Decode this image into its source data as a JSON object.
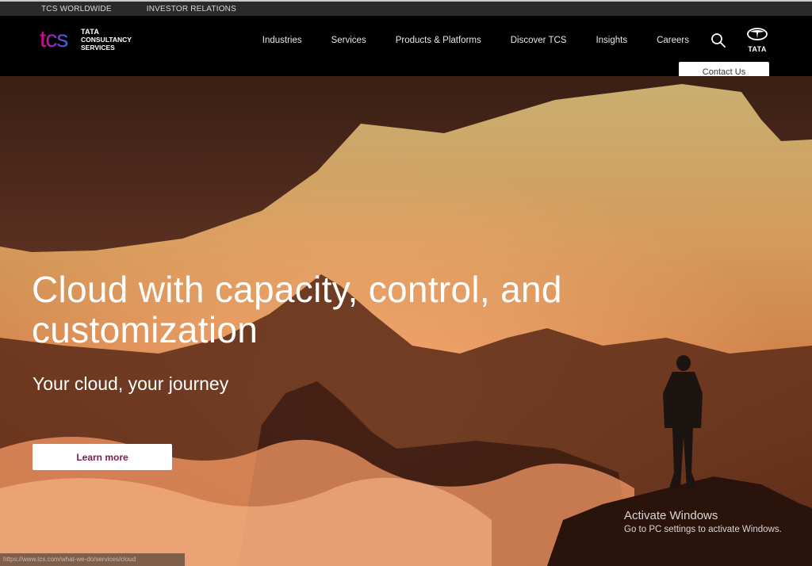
{
  "topbar": {
    "links": [
      "TCS WORLDWIDE",
      "INVESTOR RELATIONS"
    ]
  },
  "brand": {
    "logo_mark": "tcs",
    "logo_lines": [
      "TATA",
      "CONSULTANCY",
      "SERVICES"
    ],
    "tata_label": "TATA",
    "accent_gradient": [
      "#e4007c",
      "#8e2dc9",
      "#2e6fdc"
    ]
  },
  "nav": {
    "items": [
      "Industries",
      "Services",
      "Products & Platforms",
      "Discover TCS",
      "Insights",
      "Careers"
    ],
    "search_icon": "search-icon",
    "contact_label": "Contact Us"
  },
  "hero": {
    "headline_line1": "Cloud with capacity, control, and",
    "headline_line2": "customization",
    "subheadline": "Your cloud, your journey",
    "cta_label": "Learn more",
    "cta_color": "#7b1b4d"
  },
  "overlay": {
    "activate_title": "Activate Windows",
    "activate_sub": "Go to PC settings to activate Windows.",
    "status_url": "https://www.tcs.com/what-we-do/services/cloud"
  }
}
